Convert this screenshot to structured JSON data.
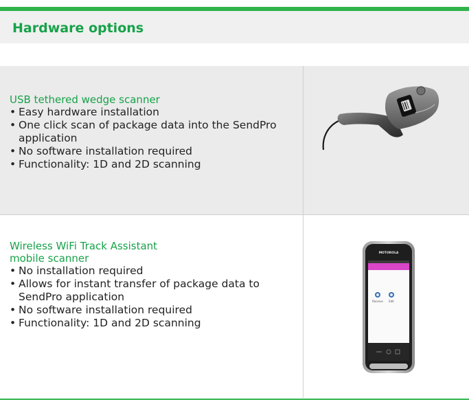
{
  "page": {
    "title": "Hardware options",
    "accent_color": "#2fb34a",
    "title_color": "#17a249"
  },
  "options": [
    {
      "title": "USB tethered wedge scanner",
      "features": [
        "Easy hardware installation",
        "One click scan of package data into the SendPro application",
        "No software installation required",
        "Functionality: 1D and 2D scanning"
      ],
      "image_icon": "handheld-barcode-scanner"
    },
    {
      "title": "Wireless WiFi Track Assistant\n mobile scanner",
      "features": [
        "No installation required",
        "Allows for instant transfer of package data to SendPro application",
        "No software installation required",
        "Functionality: 1D and 2D scanning"
      ],
      "image_icon": "mobile-scanner-phone",
      "device": {
        "brand": "MOTOROLA",
        "screen_labels": [
          "Receive",
          "Edit"
        ]
      }
    }
  ]
}
